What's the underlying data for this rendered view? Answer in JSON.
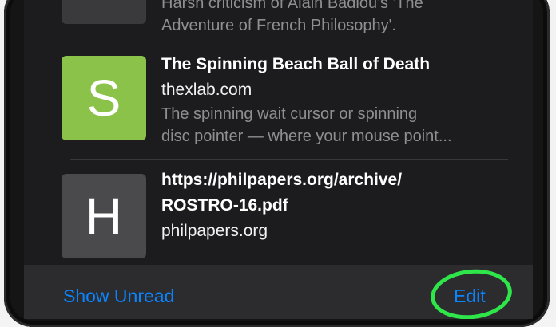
{
  "reading_list": {
    "items": [
      {
        "thumb_letter": "",
        "title": "",
        "domain": "",
        "description_lines": [
          "Harsh criticism of Alain Badiou's 'The",
          "Adventure of French Philosophy'."
        ]
      },
      {
        "thumb_letter": "S",
        "title": "The Spinning Beach Ball of Death",
        "domain": "thexlab.com",
        "description_lines": [
          "The spinning wait cursor or spinning",
          "disc pointer — where your mouse point..."
        ]
      },
      {
        "thumb_letter": "H",
        "title_lines": [
          "https://philpapers.org/archive/",
          "ROSTRO-16.pdf"
        ],
        "domain": "philpapers.org"
      }
    ]
  },
  "toolbar": {
    "show_unread_label": "Show Unread",
    "edit_label": "Edit"
  },
  "colors": {
    "accent": "#0a84ff",
    "highlight_ring": "#2ee64a",
    "thumb_s": "#8bc34a",
    "thumb_h": "#4a4a4c",
    "background": "#1c1c1e"
  }
}
